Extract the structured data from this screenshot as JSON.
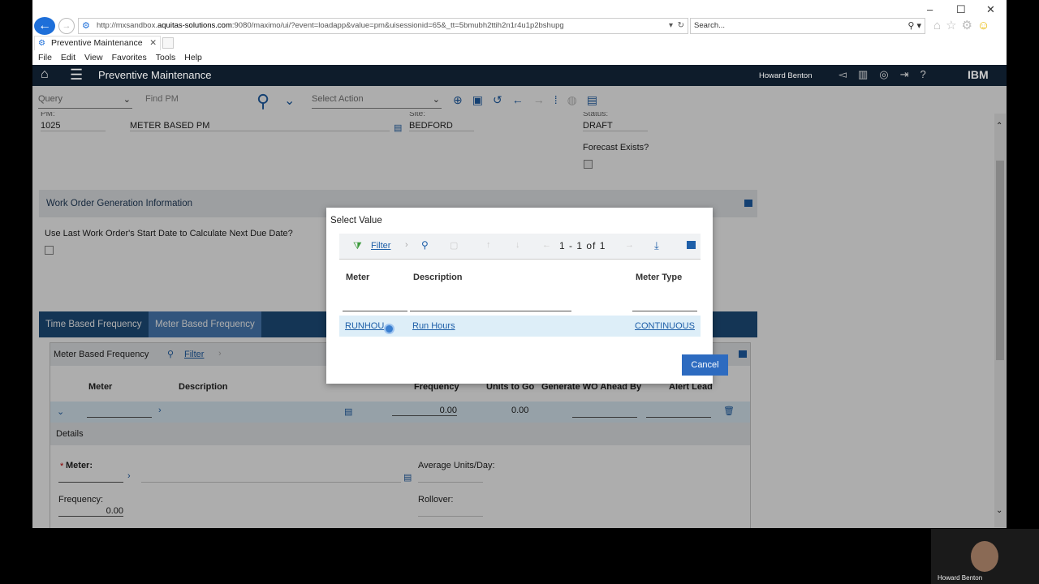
{
  "browser": {
    "url_prefix": "http://mxsandbox.",
    "url_domain": "aquitas-solutions.com",
    "url_rest": ":9080/maximo/ui/?event=loadapp&value=pm&uisessionid=65&_tt=5bmubh2ttih2n1r4u1p2bshupg",
    "search_placeholder": "Search...",
    "tab_label": "Preventive Maintenance",
    "menu": [
      "File",
      "Edit",
      "View",
      "Favorites",
      "Tools",
      "Help"
    ]
  },
  "app": {
    "title": "Preventive Maintenance",
    "user": "Howard Benton",
    "brand": "IBM"
  },
  "toolbar": {
    "query_placeholder": "Query",
    "find_placeholder": "Find PM",
    "action_placeholder": "Select Action"
  },
  "record": {
    "pm_label_cut": "PM:",
    "pm_value": "1025",
    "description": "METER BASED PM",
    "site_label_cut": "Site:",
    "site_value": "BEDFORD",
    "status_label_cut": "Status:",
    "status_value": "DRAFT",
    "forecast_label": "Forecast Exists?"
  },
  "wo_section": {
    "title": "Work Order Generation Information",
    "use_last_label": "Use Last Work Order's Start Date to Calculate Next Due Date?"
  },
  "freq_tabs": [
    "Time Based Frequency",
    "Meter Based Frequency"
  ],
  "meter_freq": {
    "title": "Meter Based Frequency",
    "filter_label": "Filter",
    "columns": [
      "Meter",
      "Description",
      "Frequency",
      "Units to Go",
      "Generate WO Ahead By",
      "Alert Lead"
    ],
    "row": {
      "frequency": "0.00",
      "units_to_go": "0.00"
    },
    "details_label": "Details",
    "meter_label": "Meter:",
    "avg_units_label": "Average Units/Day:",
    "frequency_label": "Frequency:",
    "frequency_value": "0.00",
    "rollover_label": "Rollover:"
  },
  "dialog": {
    "title": "Select Value",
    "filter_label": "Filter",
    "paging": "1 - 1 of 1",
    "columns": [
      "Meter",
      "Description",
      "Meter Type"
    ],
    "row": {
      "meter": "RUNHOURS",
      "meter_visible": "RUNHOU",
      "description": "Run Hours",
      "meter_type": "CONTINUOUS"
    },
    "cancel_label": "Cancel"
  },
  "video": {
    "name": "Howard Benton"
  }
}
